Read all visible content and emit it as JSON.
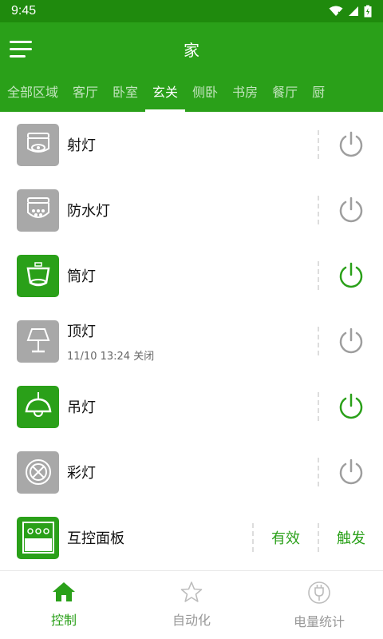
{
  "status_bar": {
    "time": "9:45"
  },
  "app_bar": {
    "title": "家"
  },
  "tabs": [
    {
      "label": "全部区域"
    },
    {
      "label": "客厅"
    },
    {
      "label": "卧室"
    },
    {
      "label": "玄关"
    },
    {
      "label": "侧卧"
    },
    {
      "label": "书房"
    },
    {
      "label": "餐厅"
    },
    {
      "label": "厨"
    }
  ],
  "active_tab": "玄关",
  "devices": [
    {
      "name": "射灯",
      "subtitle": "",
      "icon": "spotlight-icon",
      "on": false
    },
    {
      "name": "防水灯",
      "subtitle": "",
      "icon": "waterproof-light-icon",
      "on": false
    },
    {
      "name": "筒灯",
      "subtitle": "",
      "icon": "downlight-icon",
      "on": true
    },
    {
      "name": "顶灯",
      "subtitle": "11/10 13:24 关闭",
      "icon": "table-lamp-icon",
      "on": false
    },
    {
      "name": "吊灯",
      "subtitle": "",
      "icon": "pendant-lamp-icon",
      "on": true
    },
    {
      "name": "彩灯",
      "subtitle": "",
      "icon": "color-light-icon",
      "on": false
    }
  ],
  "panel": {
    "name": "互控面板",
    "action1": "有效",
    "action2": "触发",
    "icon": "switch-panel-icon"
  },
  "bottom_nav": [
    {
      "label": "控制",
      "icon": "home-icon",
      "active": true
    },
    {
      "label": "自动化",
      "icon": "star-icon",
      "active": false
    },
    {
      "label": "电量统计",
      "icon": "plug-icon",
      "active": false
    }
  ],
  "colors": {
    "primary": "#2aa019",
    "status_bar": "#1f8a0d",
    "icon_off_bg": "#a8a8a8",
    "power_off": "#9e9e9e"
  }
}
